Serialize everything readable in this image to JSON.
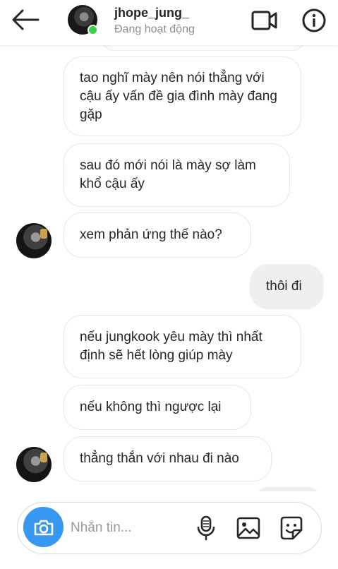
{
  "header": {
    "username": "jhope_jung_",
    "status": "Đang hoạt động",
    "online_color": "#3bcd4a",
    "icons": [
      "back-arrow-icon",
      "video-call-icon",
      "info-icon"
    ]
  },
  "messages": [
    {
      "side": "received",
      "text": "tao nghĩ mày nên nói thẳng với cậu ấy vấn đề gia đình mày đang gặp"
    },
    {
      "side": "received",
      "text": "sau đó mới nói là mày sợ làm khổ cậu ấy"
    },
    {
      "side": "received",
      "text": "xem phản ứng thế nào?"
    },
    {
      "side": "sent",
      "text": "thôi đi"
    },
    {
      "side": "received",
      "text": "nếu jungkook yêu mày thì nhất định sẽ hết lòng giúp mày"
    },
    {
      "side": "received",
      "text": "nếu không thì ngược lại"
    },
    {
      "side": "received",
      "text": "thẳng thắn với nhau đi nào"
    }
  ],
  "composer": {
    "placeholder": "Nhắn tin...",
    "accent": "#3897f0",
    "icons": [
      "camera-icon",
      "microphone-icon",
      "image-icon",
      "sticker-icon"
    ]
  }
}
